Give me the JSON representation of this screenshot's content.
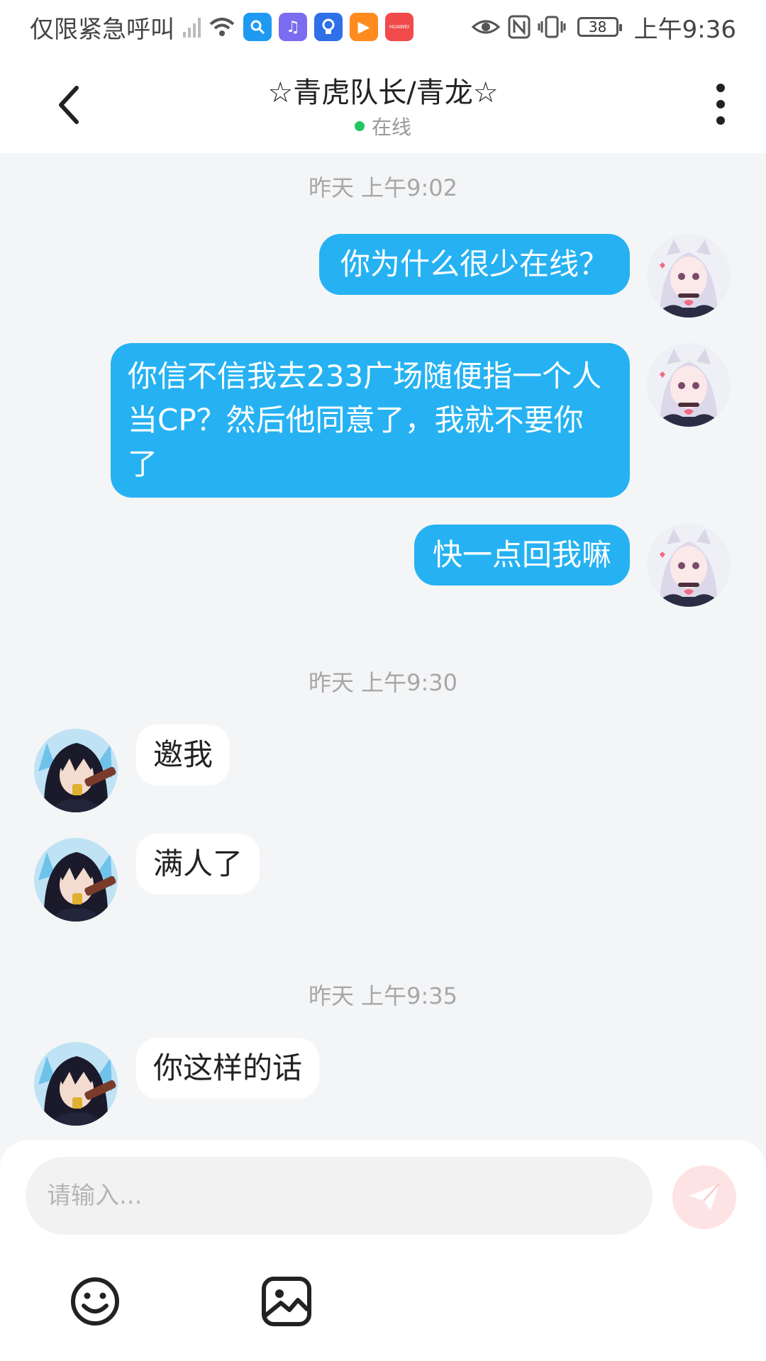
{
  "status_bar": {
    "carrier": "仅限紧急呼叫",
    "battery": "38",
    "time": "上午9:36",
    "apps": [
      {
        "icon": "search-app-icon",
        "color": "#1e9af3"
      },
      {
        "icon": "music-app-icon",
        "color": "#7b6cf0"
      },
      {
        "icon": "bulb-app-icon",
        "color": "#2f6fe8"
      },
      {
        "icon": "video-app-icon",
        "color": "#ff8a1e"
      },
      {
        "icon": "huawei-appgallery-icon",
        "color": "#f04a4a"
      }
    ],
    "huawei_label": "HUAWEI"
  },
  "header": {
    "title": "☆青虎队长/青龙☆",
    "online_status": "在线",
    "online_color": "#22c55e"
  },
  "chat": {
    "timestamps": [
      "昨天 上午9:02",
      "昨天 上午9:30",
      "昨天 上午9:35"
    ],
    "sent": [
      "你为什么很少在线？",
      "你信不信我去233广场随便指一个人当CP？然后他同意了，我就不要你了",
      "快一点回我嘛"
    ],
    "received": [
      "邀我",
      "满人了",
      "你这样的话"
    ]
  },
  "input": {
    "placeholder": "请输入..."
  },
  "colors": {
    "sent_bubble": "#26b2f2",
    "send_button": "#fde3e3"
  }
}
